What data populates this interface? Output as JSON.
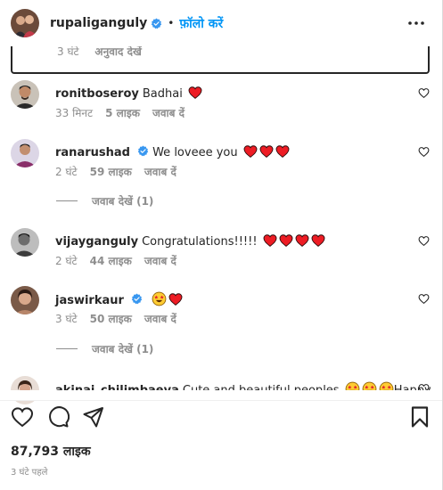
{
  "post_header": {
    "username": "rupaliganguly",
    "separator": "•",
    "follow_label": "फ़ॉलो करें"
  },
  "top_comment_meta": {
    "time": "3 घंटे",
    "translate": "अनुवाद देखें"
  },
  "comments": [
    {
      "username": "ronitboseroy",
      "text": "Badhai",
      "time": "33 मिनट",
      "likes": "5 लाइक",
      "reply": "जवाब दें"
    },
    {
      "username": "ranarushad",
      "text": "We loveee you",
      "time": "2 घंटे",
      "likes": "59 लाइक",
      "reply": "जवाब दें",
      "view_replies": "जवाब देखें (1)"
    },
    {
      "username": "vijayganguly",
      "text": "Congratulations!!!!!",
      "time": "2 घंटे",
      "likes": "44 लाइक",
      "reply": "जवाब दें"
    },
    {
      "username": "jaswirkaur",
      "text": "",
      "time": "3 घंटे",
      "likes": "50 लाइक",
      "reply": "जवाब दें",
      "view_replies": "जवाब देखें (1)"
    },
    {
      "username": "akinai_chilimbaeva",
      "text": "Cute and beautiful peoples",
      "text_after": "Happy"
    }
  ],
  "footer": {
    "likes_count": "87,793 लाइक",
    "posted": "3 घंटे पहले"
  },
  "colors": {
    "accent": "#0095f6",
    "verified": "#3897f0",
    "heart": "#ed1c24",
    "muted": "#8e8e8e"
  },
  "icons": [
    "verified-badge-icon",
    "more-options-icon",
    "red-heart-icon",
    "like-heart-icon",
    "star-struck-emoji-icon",
    "like-icon",
    "comment-icon",
    "share-icon",
    "bookmark-icon"
  ]
}
